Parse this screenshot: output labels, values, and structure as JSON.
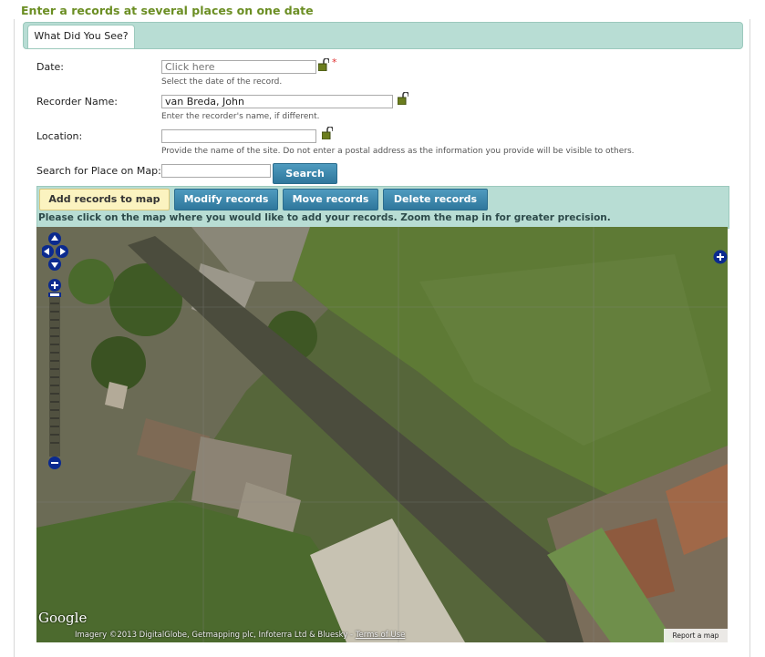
{
  "heading": "Enter a records at several places on one date",
  "tab": {
    "label": "What Did You See?"
  },
  "form": {
    "date": {
      "label": "Date:",
      "placeholder": "Click here",
      "hint": "Select the date of the record.",
      "required_marker": "*"
    },
    "recorder": {
      "label": "Recorder Name:",
      "value": "van Breda, John",
      "hint": "Enter the recorder's name, if different."
    },
    "location": {
      "label": "Location:",
      "value": "",
      "hint": "Provide the name of the site. Do not enter a postal address as the information you provide will be visible to others."
    },
    "search": {
      "label": "Search for Place on Map:",
      "value": "",
      "button": "Search"
    }
  },
  "map_tools": {
    "add": "Add records to map",
    "modify": "Modify records",
    "move": "Move records",
    "delete": "Delete records",
    "instruction": "Please click on the map where you would like to add your records. Zoom the map in for greater precision."
  },
  "map": {
    "logo_text": "Google",
    "attribution": "Imagery ©2013 DigitalGlobe, Getmapping plc, Infoterra Ltd & Bluesky - ",
    "terms": "Terms of Use",
    "report": "Report a map error"
  },
  "colors": {
    "heading": "#6b8e23",
    "tab_bar": "#b8ddd4",
    "button": "#2f779c",
    "active_tool": "#fbf3c0"
  }
}
